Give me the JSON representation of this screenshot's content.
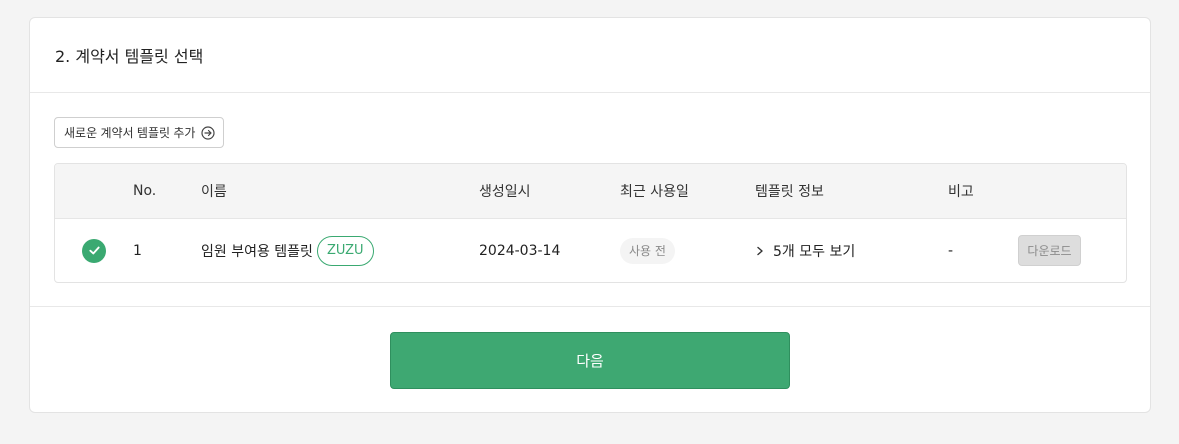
{
  "section": {
    "title": "2. 계약서 템플릿 선택"
  },
  "toolbar": {
    "add_template_label": "새로운 계약서 템플릿 추가",
    "add_icon": "arrow-right-circle-icon"
  },
  "table": {
    "columns": [
      "",
      "No.",
      "이름",
      "생성일시",
      "최근 사용일",
      "템플릿 정보",
      "비고",
      ""
    ],
    "rows": [
      {
        "selected": true,
        "no": "1",
        "name": "임원 부여용 템플릿",
        "tag": "ZUZU",
        "created": "2024-03-14",
        "last_used": "사용 전",
        "info": "5개 모두 보기",
        "note": "-",
        "download_label": "다운로드"
      }
    ]
  },
  "footer": {
    "next_label": "다음"
  },
  "colors": {
    "accent": "#3ea872",
    "tag": "#3aa971"
  }
}
